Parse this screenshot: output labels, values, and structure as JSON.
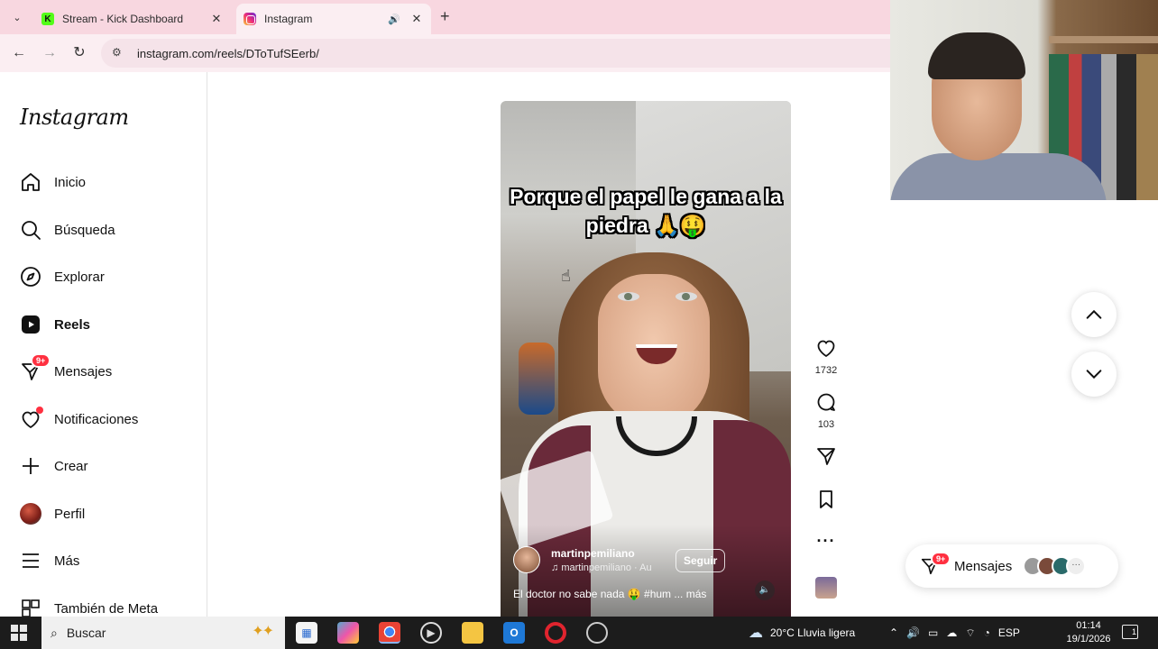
{
  "browser": {
    "tabs": [
      {
        "title": "Stream - Kick Dashboard",
        "favicon": "kick-icon",
        "active": false
      },
      {
        "title": "Instagram",
        "favicon": "instagram-icon",
        "active": true
      }
    ],
    "url": "instagram.com/reels/DToTufSEerb/"
  },
  "sidebar": {
    "logo": "Instagram",
    "items": [
      {
        "label": "Inicio",
        "icon": "home-icon"
      },
      {
        "label": "Búsqueda",
        "icon": "search-icon"
      },
      {
        "label": "Explorar",
        "icon": "compass-icon"
      },
      {
        "label": "Reels",
        "icon": "reels-icon",
        "active": true
      },
      {
        "label": "Mensajes",
        "icon": "messenger-icon",
        "badge": "9+"
      },
      {
        "label": "Notificaciones",
        "icon": "heart-icon"
      },
      {
        "label": "Crear",
        "icon": "plus-icon"
      },
      {
        "label": "Perfil",
        "icon": "avatar"
      },
      {
        "label": "Más",
        "icon": "menu-icon"
      },
      {
        "label": "También de Meta",
        "icon": "grid-icon"
      }
    ]
  },
  "reel": {
    "overlay_text": "Porque el papel le gana a la piedra 🙏🤑",
    "author": "martinpemiliano",
    "audio": "martinpemiliano · Au",
    "follow_label": "Seguir",
    "description": "El doctor no sabe nada 🤑 #hum ... más",
    "likes": "1732",
    "comments": "103"
  },
  "messages_pill": {
    "label": "Mensajes",
    "badge": "9+"
  },
  "taskbar": {
    "search_placeholder": "Buscar",
    "weather": "20°C  Lluvia ligera",
    "language": "ESP",
    "time": "01:14",
    "date": "19/1/2026",
    "notifications": "1"
  },
  "colors": {
    "accent_red": "#ff3040",
    "tab_bar": "#f8d7e0",
    "taskbar": "#1c1c1c"
  }
}
